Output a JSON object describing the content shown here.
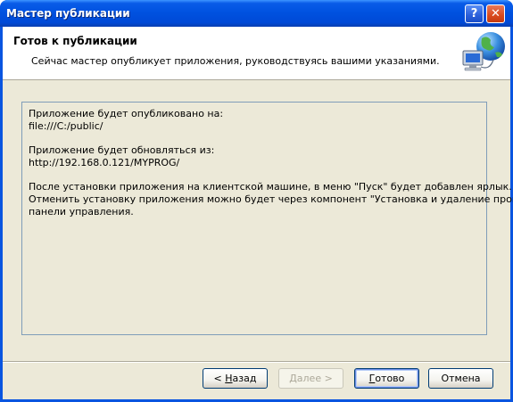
{
  "window": {
    "title": "Мастер публикации"
  },
  "titlebar": {
    "help_label": "?",
    "close_label": "✕"
  },
  "header": {
    "title": "Готов к публикации",
    "subtitle": "Сейчас мастер опубликует приложения, руководствуясь вашими указаниями.",
    "icon": "globe-computer-icon"
  },
  "summary": {
    "publish_label": "Приложение будет опубликовано на:",
    "publish_location": "file:///C:/public/",
    "update_label": "Приложение будет обновляться из:",
    "update_location": "http://192.168.0.121/MYPROG/",
    "line1": "После установки приложения на клиентской машине, в меню \"Пуск\" будет добавлен ярлык.",
    "line2": "Отменить установку приложения можно будет через компонент \"Установка и удаление программ\"",
    "line3": "панели управления."
  },
  "buttons": {
    "back_prefix": "< ",
    "back_mnemonic": "Н",
    "back_rest": "азад",
    "next_label": "Далее >",
    "finish_mnemonic": "Г",
    "finish_rest": "отово",
    "cancel_label": "Отмена"
  }
}
